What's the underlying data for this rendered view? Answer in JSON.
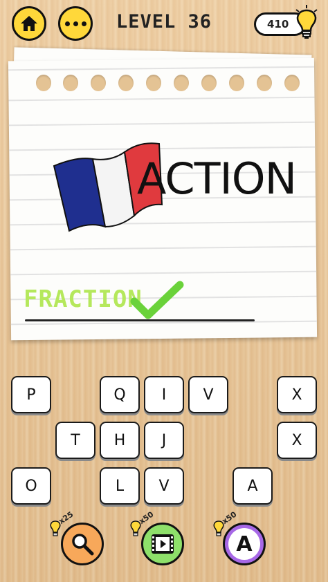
{
  "header": {
    "level_title": "LEVEL 36",
    "coins": "410",
    "home_icon": "home-icon",
    "menu_icon": "more-dots-icon",
    "coin_icon": "lightbulb-icon"
  },
  "puzzle": {
    "clue_word": "ACTION",
    "clue_image": "france-flag",
    "answer": "FRACTION",
    "answer_status": "correct"
  },
  "letter_tiles": {
    "r1": [
      "P",
      "Q",
      "I",
      "V",
      "X"
    ],
    "r2": [
      "T",
      "H",
      "J",
      "X"
    ],
    "r3": [
      "O",
      "L",
      "V",
      "A"
    ]
  },
  "hints": {
    "search": {
      "cost": "x25",
      "icon": "magnifier-icon"
    },
    "video": {
      "cost": "x50",
      "icon": "film-play-icon"
    },
    "letter": {
      "cost": "x50",
      "label": "A"
    }
  },
  "colors": {
    "header_buttons": "#ffd83a",
    "answer_text": "#b5e85c",
    "check": "#6ad23a",
    "hint_search": "#f7a85a",
    "hint_video": "#8ee06a",
    "hint_letter": "#a768e6",
    "flag_blue": "#1f2f8f",
    "flag_white": "#f4f4f4",
    "flag_red": "#e03a3e"
  }
}
